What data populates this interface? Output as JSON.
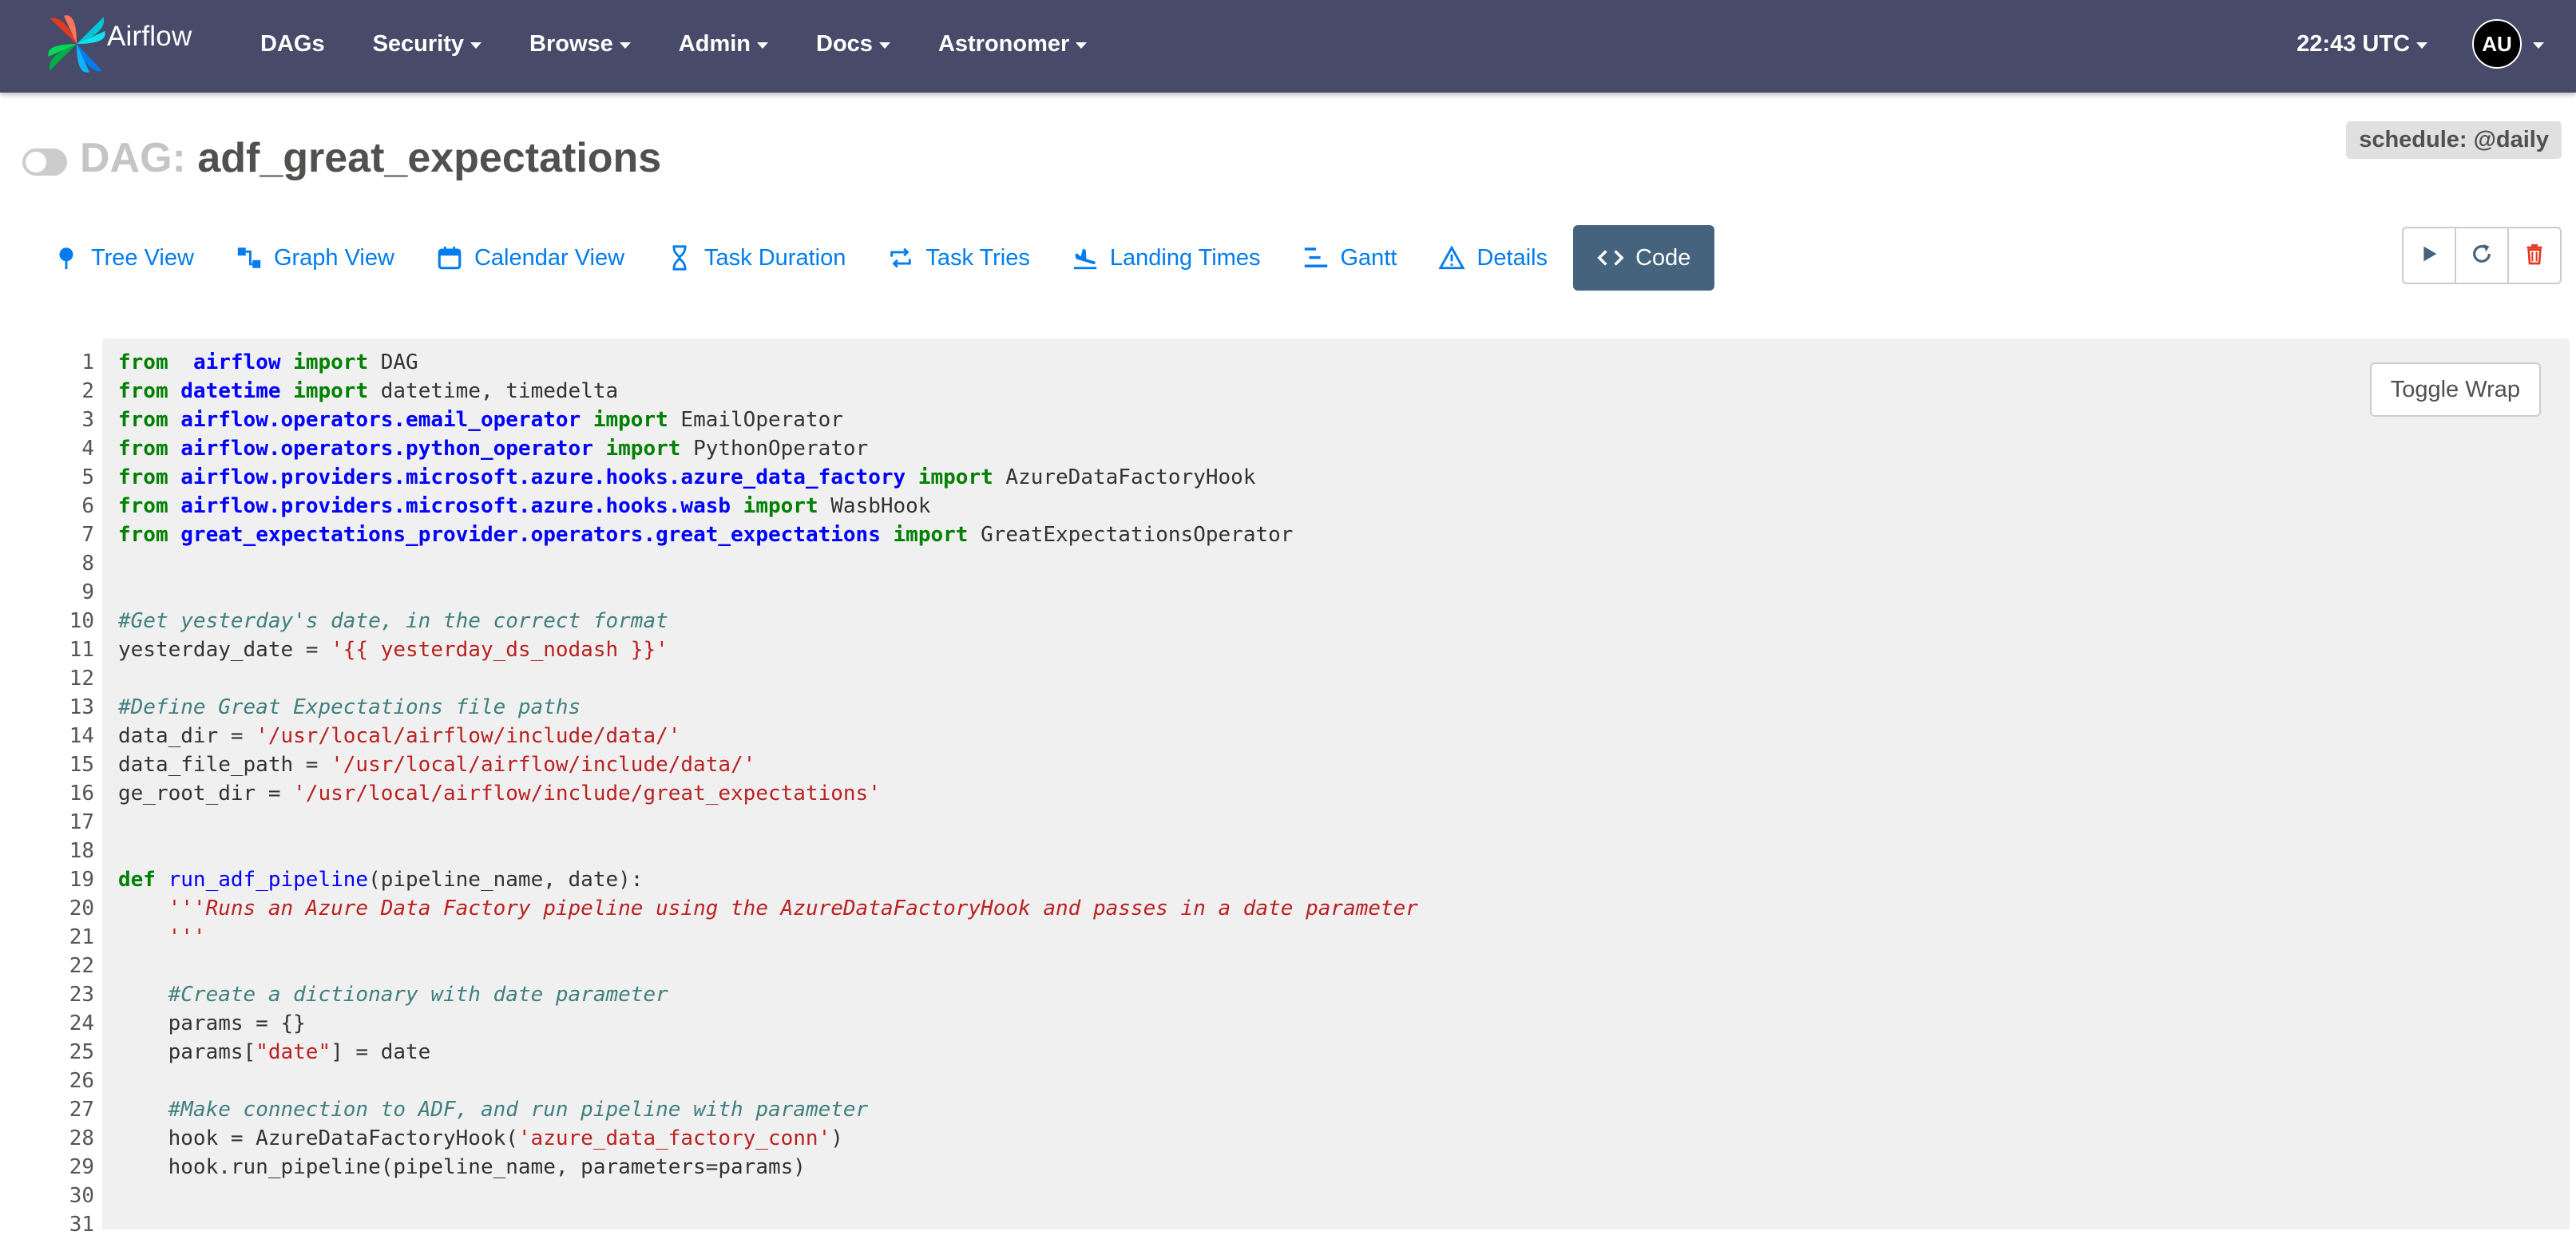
{
  "navbar": {
    "brand": "Airflow",
    "items": [
      {
        "label": "DAGs",
        "dropdown": false
      },
      {
        "label": "Security",
        "dropdown": true
      },
      {
        "label": "Browse",
        "dropdown": true
      },
      {
        "label": "Admin",
        "dropdown": true
      },
      {
        "label": "Docs",
        "dropdown": true
      },
      {
        "label": "Astronomer",
        "dropdown": true
      }
    ],
    "clock": "22:43 UTC",
    "user_initials": "AU"
  },
  "header": {
    "dag_prefix": "DAG:",
    "dag_id": "adf_great_expectations",
    "paused": true,
    "schedule": "schedule: @daily"
  },
  "tabs": [
    {
      "label": "Tree View",
      "icon": "tree-icon",
      "active": false
    },
    {
      "label": "Graph View",
      "icon": "graph-icon",
      "active": false
    },
    {
      "label": "Calendar View",
      "icon": "calendar-icon",
      "active": false
    },
    {
      "label": "Task Duration",
      "icon": "hourglass-icon",
      "active": false
    },
    {
      "label": "Task Tries",
      "icon": "repeat-icon",
      "active": false
    },
    {
      "label": "Landing Times",
      "icon": "plane-landing-icon",
      "active": false
    },
    {
      "label": "Gantt",
      "icon": "gantt-icon",
      "active": false
    },
    {
      "label": "Details",
      "icon": "warning-triangle-icon",
      "active": false
    },
    {
      "label": "Code",
      "icon": "code-icon",
      "active": true
    }
  ],
  "actions": [
    {
      "name": "trigger-dag-button",
      "icon": "play-icon"
    },
    {
      "name": "refresh-dag-button",
      "icon": "refresh-icon"
    },
    {
      "name": "delete-dag-button",
      "icon": "trash-icon"
    }
  ],
  "code": {
    "toggle_wrap_label": "Toggle Wrap",
    "lines": [
      [
        [
          "kw",
          "from"
        ],
        [
          "",
          "  "
        ],
        [
          "mod",
          "airflow"
        ],
        [
          "",
          " "
        ],
        [
          "kw",
          "import"
        ],
        [
          "",
          " DAG"
        ]
      ],
      [
        [
          "kw",
          "from"
        ],
        [
          "",
          " "
        ],
        [
          "mod",
          "datetime"
        ],
        [
          "",
          " "
        ],
        [
          "kw",
          "import"
        ],
        [
          "",
          " datetime, timedelta"
        ]
      ],
      [
        [
          "kw",
          "from"
        ],
        [
          "",
          " "
        ],
        [
          "mod",
          "airflow.operators.email_operator"
        ],
        [
          "",
          " "
        ],
        [
          "kw",
          "import"
        ],
        [
          "",
          " EmailOperator"
        ]
      ],
      [
        [
          "kw",
          "from"
        ],
        [
          "",
          " "
        ],
        [
          "mod",
          "airflow.operators.python_operator"
        ],
        [
          "",
          " "
        ],
        [
          "kw",
          "import"
        ],
        [
          "",
          " PythonOperator"
        ]
      ],
      [
        [
          "kw",
          "from"
        ],
        [
          "",
          " "
        ],
        [
          "mod",
          "airflow.providers.microsoft.azure.hooks.azure_data_factory"
        ],
        [
          "",
          " "
        ],
        [
          "kw",
          "import"
        ],
        [
          "",
          " AzureDataFactoryHook"
        ]
      ],
      [
        [
          "kw",
          "from"
        ],
        [
          "",
          " "
        ],
        [
          "mod",
          "airflow.providers.microsoft.azure.hooks.wasb"
        ],
        [
          "",
          " "
        ],
        [
          "kw",
          "import"
        ],
        [
          "",
          " WasbHook"
        ]
      ],
      [
        [
          "kw",
          "from"
        ],
        [
          "",
          " "
        ],
        [
          "mod",
          "great_expectations_provider.operators.great_expectations"
        ],
        [
          "",
          " "
        ],
        [
          "kw",
          "import"
        ],
        [
          "",
          " GreatExpectationsOperator"
        ]
      ],
      [],
      [],
      [
        [
          "cm",
          "#Get yesterday's date, in the correct format"
        ]
      ],
      [
        [
          "",
          "yesterday_date = "
        ],
        [
          "str",
          "'{{ yesterday_ds_nodash }}'"
        ]
      ],
      [],
      [
        [
          "cm",
          "#Define Great Expectations file paths"
        ]
      ],
      [
        [
          "",
          "data_dir = "
        ],
        [
          "str",
          "'/usr/local/airflow/include/data/'"
        ]
      ],
      [
        [
          "",
          "data_file_path = "
        ],
        [
          "str",
          "'/usr/local/airflow/include/data/'"
        ]
      ],
      [
        [
          "",
          "ge_root_dir = "
        ],
        [
          "str",
          "'/usr/local/airflow/include/great_expectations'"
        ]
      ],
      [],
      [],
      [
        [
          "kw",
          "def"
        ],
        [
          "",
          " "
        ],
        [
          "fn",
          "run_adf_pipeline"
        ],
        [
          "",
          "(pipeline_name, date):"
        ]
      ],
      [
        [
          "",
          "    "
        ],
        [
          "doc",
          "'''Runs an Azure Data Factory pipeline using the AzureDataFactoryHook and passes in a date parameter"
        ]
      ],
      [
        [
          "",
          "    "
        ],
        [
          "doc",
          "'''"
        ]
      ],
      [],
      [
        [
          "",
          "    "
        ],
        [
          "cm",
          "#Create a dictionary with date parameter"
        ]
      ],
      [
        [
          "",
          "    params = {}"
        ]
      ],
      [
        [
          "",
          "    params["
        ],
        [
          "str",
          "\"date\""
        ],
        [
          "",
          "] = date"
        ]
      ],
      [],
      [
        [
          "",
          "    "
        ],
        [
          "cm",
          "#Make connection to ADF, and run pipeline with parameter"
        ]
      ],
      [
        [
          "",
          "    hook = AzureDataFactoryHook("
        ],
        [
          "str",
          "'azure_data_factory_conn'"
        ],
        [
          "",
          ")"
        ]
      ],
      [
        [
          "",
          "    hook.run_pipeline(pipeline_name, parameters=params)"
        ]
      ],
      [],
      []
    ]
  }
}
